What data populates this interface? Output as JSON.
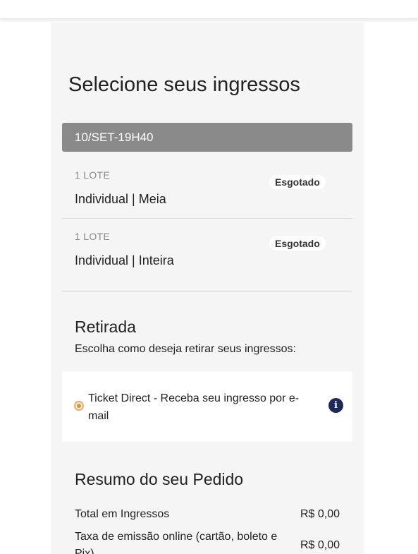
{
  "page": {
    "title": "Selecione seus ingressos"
  },
  "session": {
    "label": "10/SET-19H40"
  },
  "tickets": [
    {
      "lot": "1 LOTE",
      "name": "Individual | Meia",
      "status": "Esgotado"
    },
    {
      "lot": "1 LOTE",
      "name": "Individual | Inteira",
      "status": "Esgotado"
    }
  ],
  "retirada": {
    "title": "Retirada",
    "description": "Escolha como deseja retirar seus ingressos:",
    "option": {
      "label": "Ticket Direct - Receba seu ingresso por e-mail",
      "selected": true,
      "info_icon_glyph": "i"
    }
  },
  "summary": {
    "title": "Resumo do seu Pedido",
    "rows": [
      {
        "label": "Total em Ingressos",
        "value": "R$ 0,00"
      },
      {
        "label": "Taxa de emissão online (cartão, boleto e Pix)",
        "value": "R$ 0,00"
      }
    ]
  },
  "colors": {
    "panel_bg": "#f5f5f5",
    "session_bar": "#8a8a8a",
    "radio_accent": "#f08a24",
    "info_icon": "#1d2a5c"
  }
}
